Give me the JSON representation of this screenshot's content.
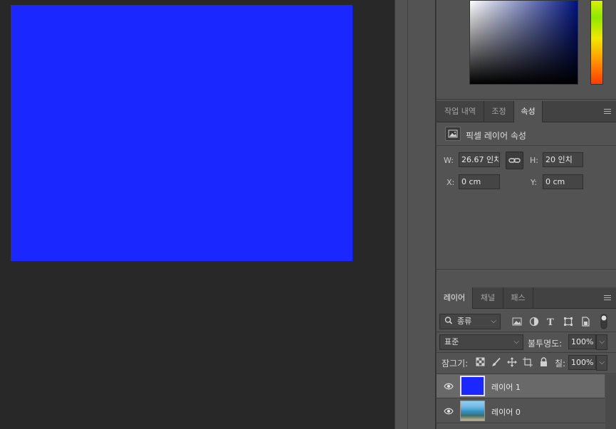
{
  "canvas": {
    "fill_color": "#1a27ff"
  },
  "color_picker": {
    "field_base": "#00137f"
  },
  "properties_panel": {
    "tabs": [
      {
        "label": "작업 내역",
        "active": false
      },
      {
        "label": "조정",
        "active": false
      },
      {
        "label": "속성",
        "active": true
      }
    ],
    "header_title": "픽셀 레이어 속성",
    "w_label": "W:",
    "w_value": "26.67 인치",
    "h_label": "H:",
    "h_value": "20 인치",
    "x_label": "X:",
    "x_value": "0 cm",
    "y_label": "Y:",
    "y_value": "0 cm"
  },
  "layers_panel": {
    "tabs": [
      {
        "label": "레이어",
        "active": true
      },
      {
        "label": "채널",
        "active": false
      },
      {
        "label": "패스",
        "active": false
      }
    ],
    "filter_label": "종류",
    "blend_mode": "표준",
    "opacity_label": "불투명도:",
    "opacity_value": "100%",
    "lock_label": "잠그기:",
    "fill_label": "칠:",
    "fill_value": "100%",
    "layers": [
      {
        "name": "레이어 1",
        "selected": true,
        "thumb_color": "#1a27ff"
      },
      {
        "name": "레이어 0",
        "selected": false,
        "thumb_color": "#3aa0c8"
      }
    ]
  },
  "icons": {
    "filter": "search-icon",
    "image_filter": "image-filter-icon",
    "adjustment_filter": "adjustment-filter-icon",
    "type_filter": "type-filter-icon",
    "shape_filter": "shape-filter-icon",
    "smart_object_filter": "smart-object-filter-icon",
    "filter_toggle": "toggle-icon",
    "lock_transparency": "lock-transparency-icon",
    "lock_paint": "brush-icon",
    "lock_position": "move-icon",
    "lock_artboard": "artboard-icon",
    "lock_all": "lock-icon",
    "visibility": "eye-icon",
    "link": "link-icon",
    "menu": "panel-menu-icon"
  }
}
